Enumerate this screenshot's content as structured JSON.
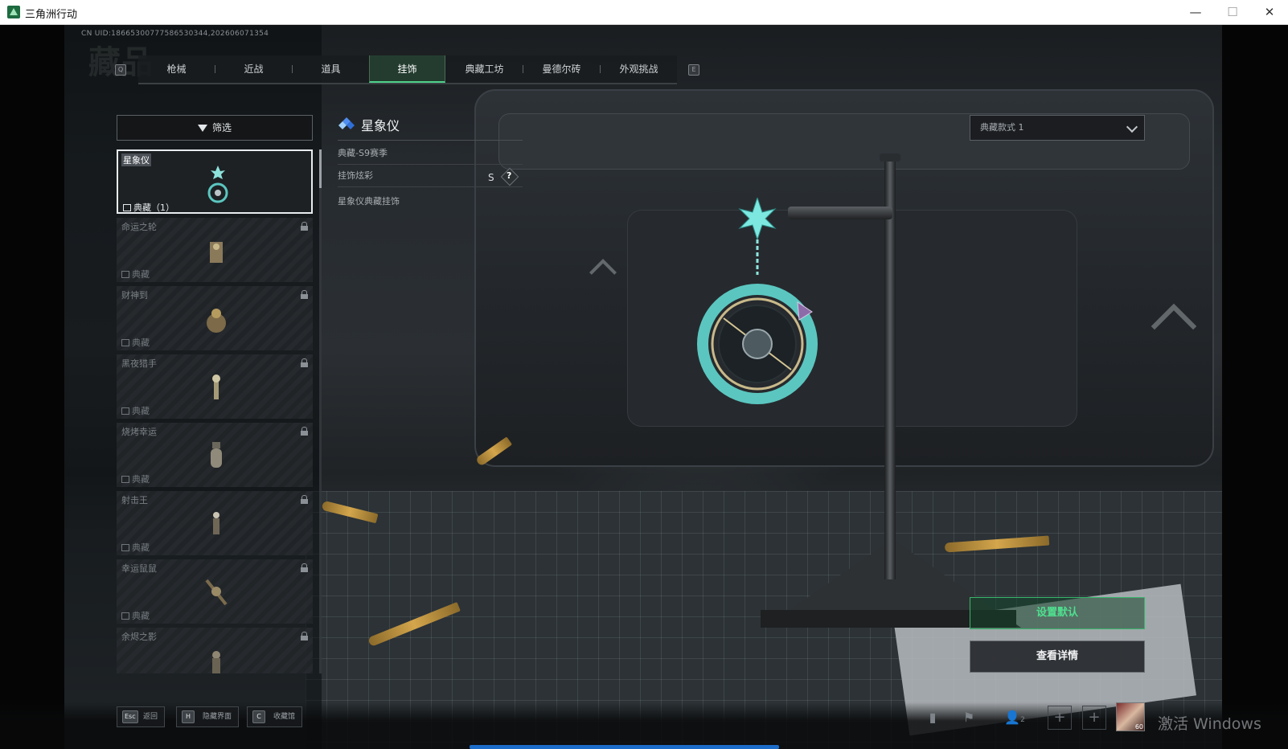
{
  "window": {
    "title": "三角洲行动",
    "minimize_glyph": "—",
    "maximize_glyph": "☐",
    "close_glyph": "✕",
    "icon": "delta-logo-icon"
  },
  "uid_text": "CN UID:18665300777586530344,202606071354",
  "ghost_title": "藏品",
  "tabs": {
    "left_key": "Q",
    "right_key": "E",
    "items": [
      {
        "label": "枪械",
        "active": false
      },
      {
        "label": "近战",
        "active": false
      },
      {
        "label": "道具",
        "active": false
      },
      {
        "label": "挂饰",
        "active": true
      },
      {
        "label": "典藏工坊",
        "active": false
      },
      {
        "label": "曼德尔砖",
        "active": false
      },
      {
        "label": "外观挑战",
        "active": false
      }
    ]
  },
  "filter": {
    "label": "筛选",
    "icon": "filter-icon"
  },
  "items": [
    {
      "name": "星象仪",
      "rarity": "典藏（1）",
      "locked": false,
      "selected": true
    },
    {
      "name": "命运之轮",
      "rarity": "典藏",
      "locked": true,
      "selected": false
    },
    {
      "name": "财神到",
      "rarity": "典藏",
      "locked": true,
      "selected": false
    },
    {
      "name": "黑夜猎手",
      "rarity": "典藏",
      "locked": true,
      "selected": false
    },
    {
      "name": "烧烤幸运",
      "rarity": "典藏",
      "locked": true,
      "selected": false
    },
    {
      "name": "射击王",
      "rarity": "典藏",
      "locked": true,
      "selected": false
    },
    {
      "name": "幸运鼠鼠",
      "rarity": "典藏",
      "locked": true,
      "selected": false
    },
    {
      "name": "余烬之影",
      "rarity": "典藏",
      "locked": true,
      "selected": false
    }
  ],
  "detail": {
    "title": "星象仪",
    "season": "典藏-S9赛季",
    "effect_label": "挂饰炫彩",
    "grade": "S",
    "help": "?",
    "description": "星象仪典藏挂饰"
  },
  "style_select": {
    "value": "典藏款式 1"
  },
  "actions": {
    "set_default": "设置默认",
    "view_detail": "查看详情"
  },
  "hints": [
    {
      "key": "Esc",
      "label": "返回"
    },
    {
      "key": "H",
      "label": "隐藏界面"
    },
    {
      "key": "C",
      "label": "收藏馆"
    }
  ],
  "bottom_right": {
    "friends_count": "2",
    "avatar_level": "60"
  },
  "watermark": "激活 Windows",
  "colors": {
    "accent_green": "#4fe08f",
    "tab_active": "#4fd28c",
    "progress_blue": "#1c6cc9",
    "charm_teal": "#6fd6d0"
  }
}
